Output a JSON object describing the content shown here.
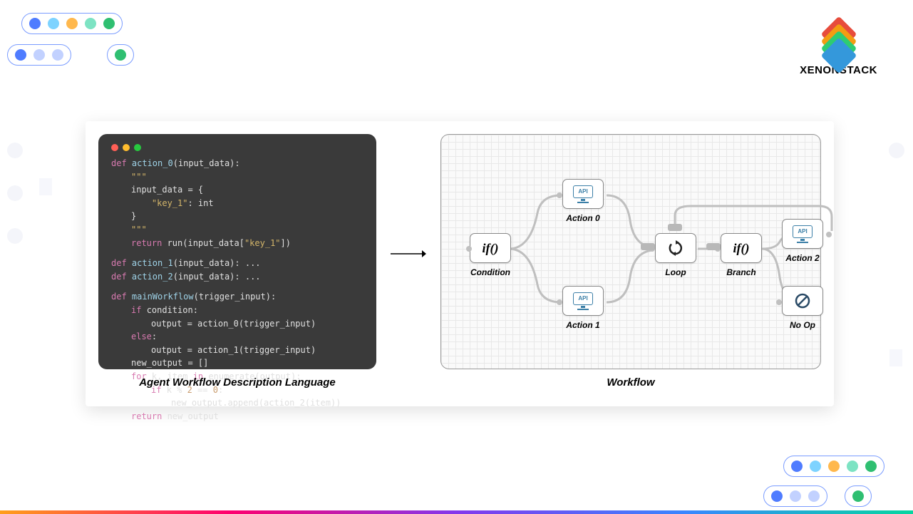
{
  "brand": "XENONSTACK",
  "captions": {
    "left": "Agent Workflow Description Language",
    "right": "Workflow"
  },
  "code": {
    "l1a": "def ",
    "l1b": "action_0",
    "l1c": "(input_data):",
    "l2": "\"\"\"",
    "l3": "input_data = {",
    "l4a": "    ",
    "l4b": "\"key_1\"",
    "l4c": ": int",
    "l5": "}",
    "l6": "\"\"\"",
    "l7a": "return ",
    "l7b": "run(input_data[",
    "l7c": "\"key_1\"",
    "l7d": "])",
    "l8a": "def ",
    "l8b": "action_1",
    "l8c": "(input_data): ...",
    "l9a": "def ",
    "l9b": "action_2",
    "l9c": "(input_data): ...",
    "l10a": "def ",
    "l10b": "mainWorkflow",
    "l10c": "(trigger_input):",
    "l11a": "if ",
    "l11b": "condition:",
    "l12": "output = action_0(trigger_input)",
    "l13a": "else",
    "l13b": ":",
    "l14": "output = action_1(trigger_input)",
    "l15": "new_output = []",
    "l16a": "for ",
    "l16b": "k, item ",
    "l16c": "in ",
    "l16d": "enumerate(output):",
    "l17a": "if ",
    "l17b": "k % ",
    "l17c": "2",
    "l17d": " == ",
    "l17e": "0",
    "l17f": ":",
    "l18": "new_output.append(action_2(item))",
    "l19a": "return ",
    "l19b": "new_output"
  },
  "nodes": {
    "condition": {
      "label": "Condition",
      "glyph": "if()"
    },
    "action0": {
      "label": "Action 0",
      "badge": "API"
    },
    "action1": {
      "label": "Action 1",
      "badge": "API"
    },
    "loop": {
      "label": "Loop"
    },
    "branch": {
      "label": "Branch",
      "glyph": "if()"
    },
    "action2": {
      "label": "Action 2",
      "badge": "API"
    },
    "noop": {
      "label": "No Op"
    }
  }
}
